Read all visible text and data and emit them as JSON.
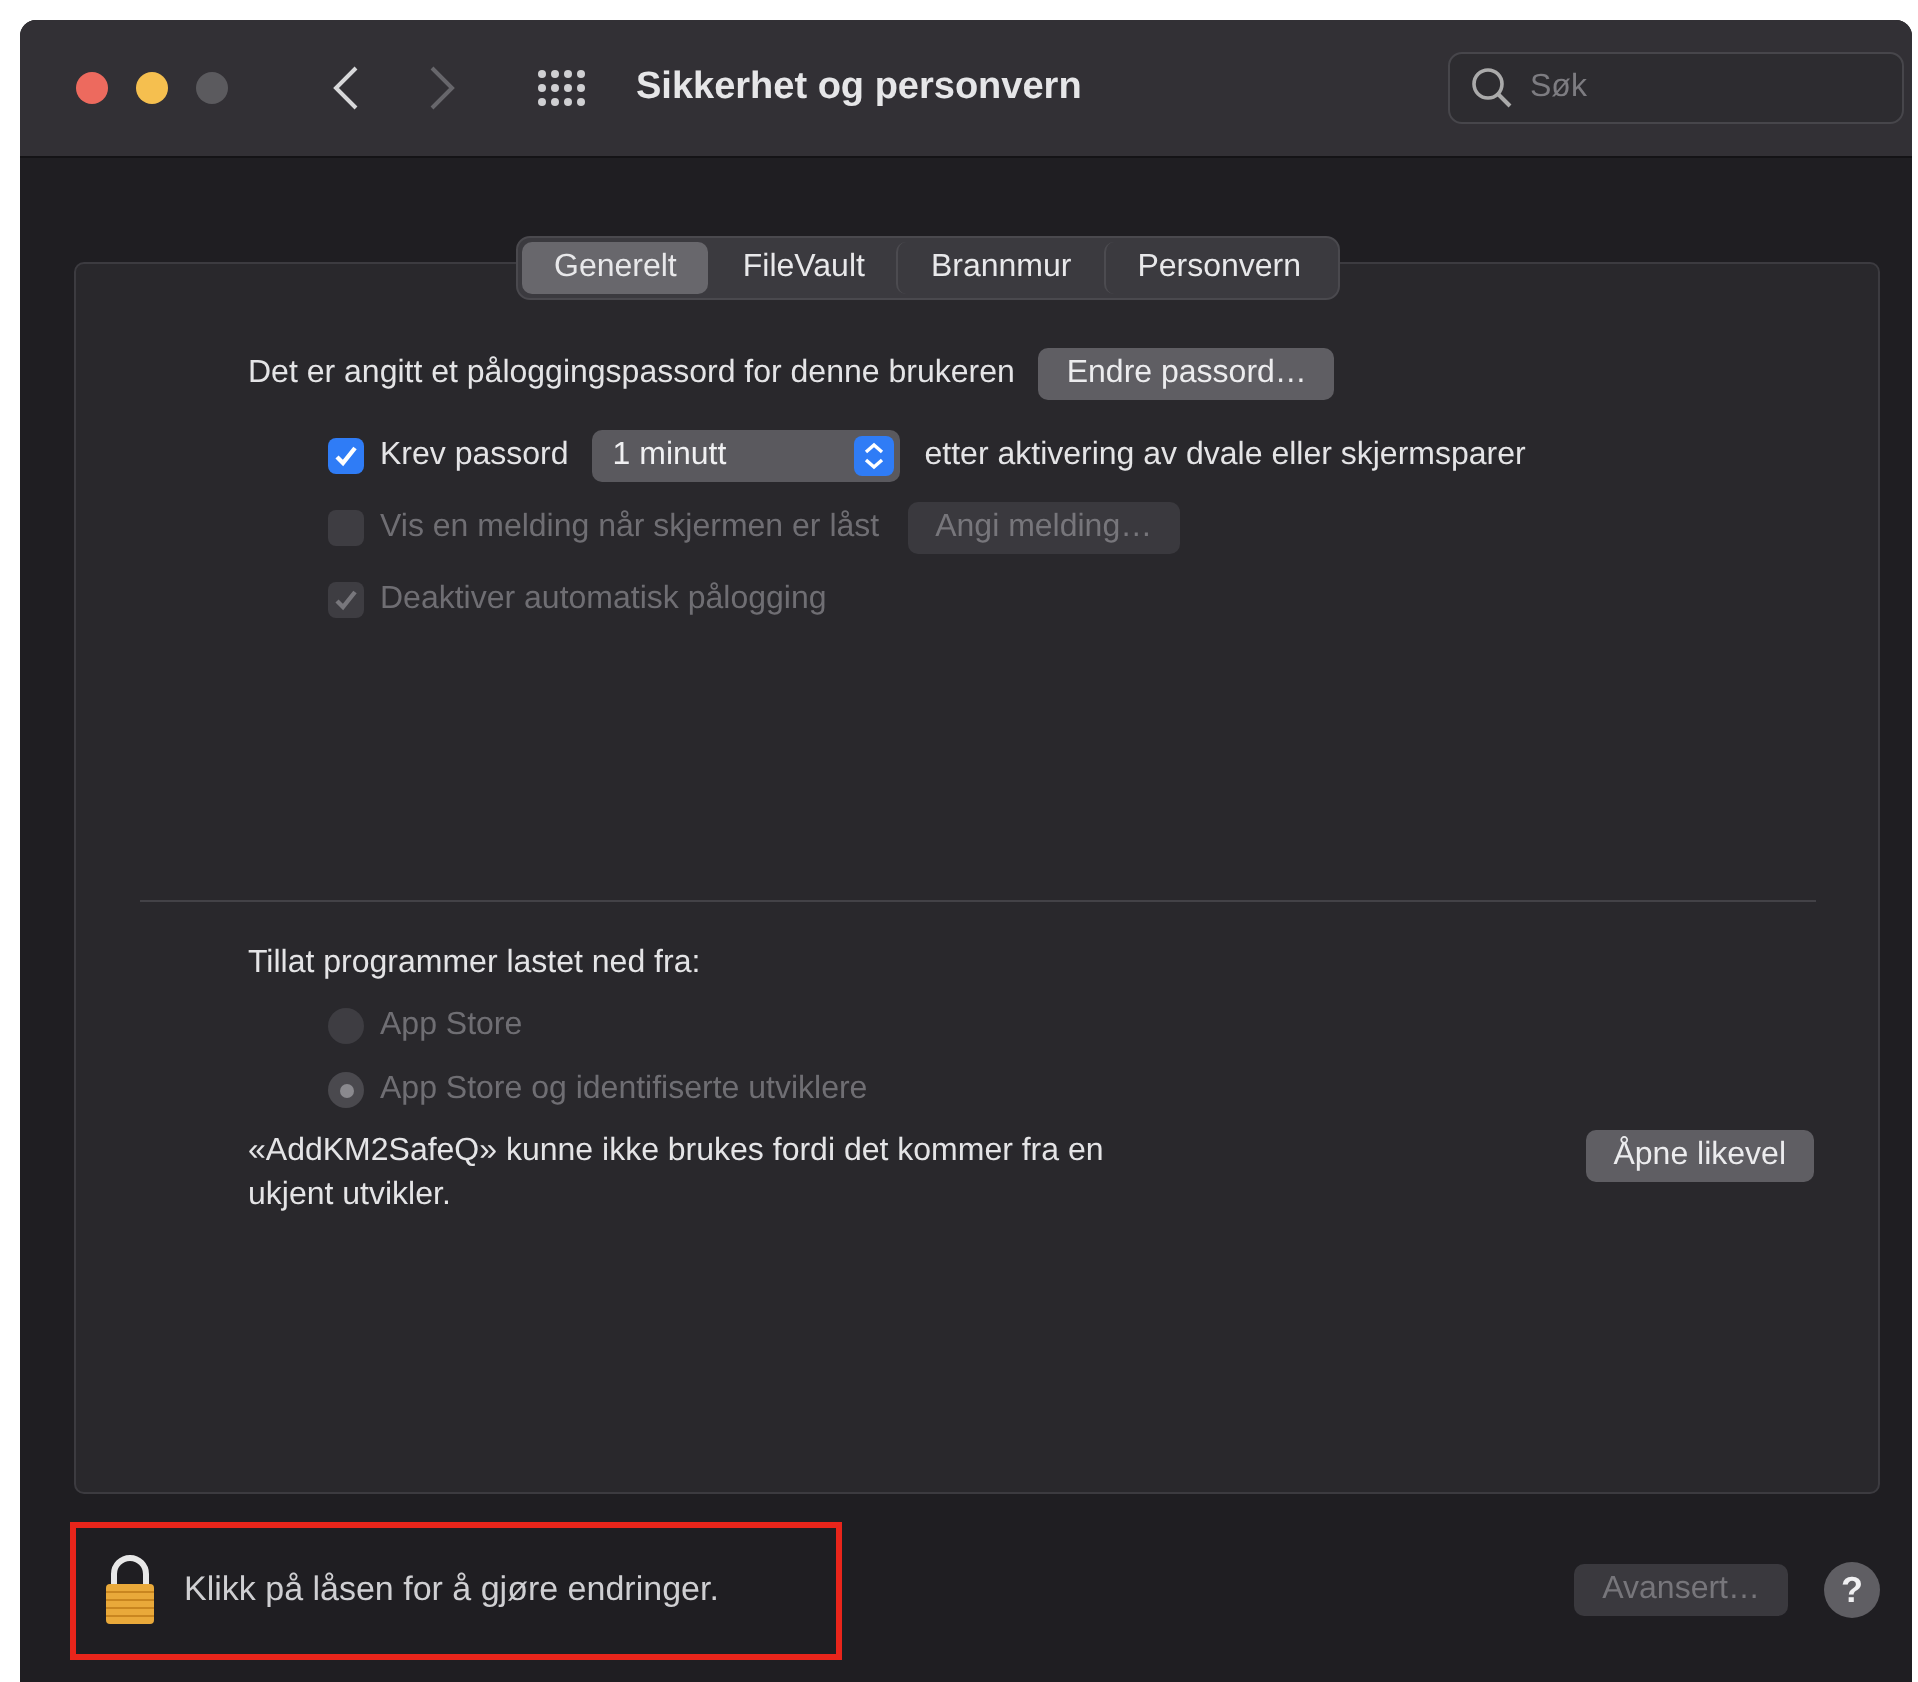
{
  "window": {
    "title": "Sikkerhet og personvern",
    "traffic_lights": [
      {
        "color": "#ed6a5e"
      },
      {
        "color": "#f5bf4f"
      },
      {
        "color": "#5b5a5e"
      }
    ],
    "nav": [
      {
        "kind": "back",
        "disabled": false
      },
      {
        "kind": "forward",
        "disabled": true
      }
    ]
  },
  "search": {
    "placeholder": "Søk"
  },
  "tabs": [
    {
      "label": "Generelt",
      "selected": true
    },
    {
      "label": "FileVault",
      "selected": false
    },
    {
      "label": "Brannmur",
      "selected": false
    },
    {
      "label": "Personvern",
      "selected": false
    }
  ],
  "general": {
    "password_text": "Det er angitt et påloggingspassord for denne brukeren",
    "change_button": {
      "label": "Endre passord…",
      "disabled": false
    },
    "options": [
      {
        "kind": "popup",
        "label": "Krev passord",
        "checked": true,
        "disabled": false,
        "popup": "1 minutt",
        "suffix": "etter aktivering av dvale eller skjermsparer"
      },
      {
        "kind": "button",
        "label": "Vis en melding når skjermen er låst",
        "checked": false,
        "disabled": true,
        "button": "Angi melding…"
      },
      {
        "kind": "plain",
        "label": "Deaktiver automatisk pålogging",
        "checked": true,
        "disabled": true
      }
    ]
  },
  "downloads": {
    "heading": "Tillat programmer lastet ned fra:",
    "options": [
      {
        "label": "App Store",
        "selected": false,
        "disabled": true
      },
      {
        "label": "App Store og identifiserte utviklere",
        "selected": true,
        "disabled": true
      }
    ],
    "notice": "«AddKM2SafeQ» kunne ikke brukes fordi det kommer fra en ukjent utvikler.",
    "open_button": {
      "label": "Åpne likevel",
      "disabled": false
    }
  },
  "footer": {
    "lock_text": "Klikk på låsen for å gjøre endringer.",
    "highlighted": true,
    "advanced_button": {
      "label": "Avansert…",
      "disabled": true
    },
    "help": "?"
  }
}
